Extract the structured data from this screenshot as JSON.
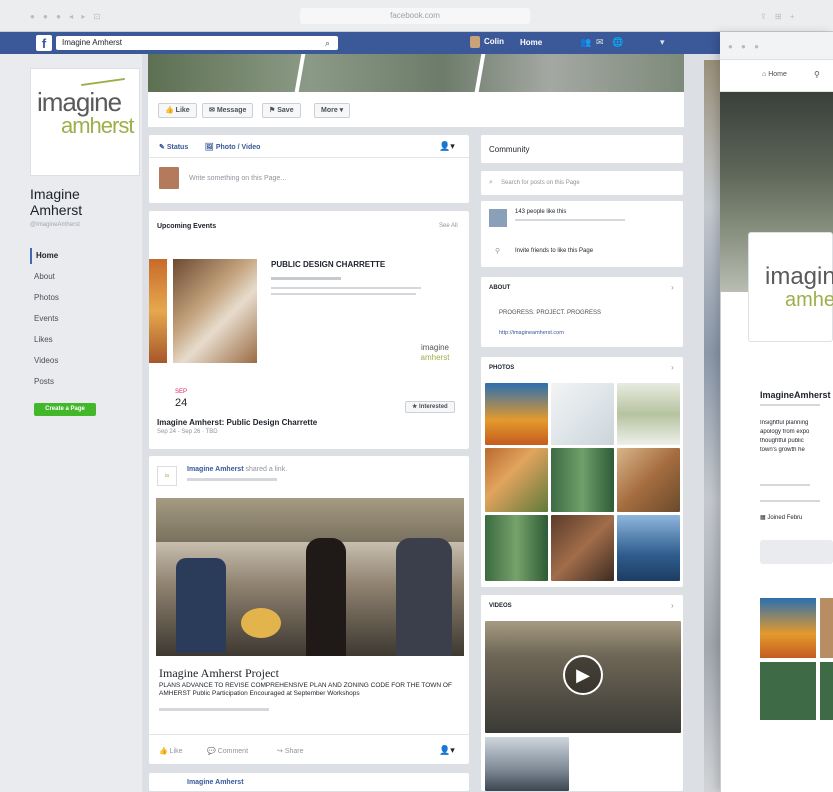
{
  "browser": {
    "url": "facebook.com"
  },
  "fb": {
    "search_value": "Imagine Amherst",
    "user": "Colin",
    "home": "Home"
  },
  "page": {
    "logo_line1": "imagine",
    "logo_line2": "amherst",
    "name_line1": "Imagine",
    "name_line2": "Amherst",
    "handle": "@ImagineAmherst",
    "nav": [
      "Home",
      "About",
      "Photos",
      "Events",
      "Likes",
      "Videos",
      "Posts"
    ],
    "create_page": "Create a Page"
  },
  "actions": {
    "like": "Like",
    "message": "Message",
    "save": "Save",
    "more": "More"
  },
  "composer": {
    "status": "Status",
    "photo_video": "Photo / Video",
    "placeholder": "Write something on this Page..."
  },
  "events": {
    "header": "Upcoming Events",
    "see_all": "See All",
    "charrette_title": "PUBLIC DESIGN CHARRETTE",
    "month": "SEP",
    "day": "24",
    "event_title": "Imagine Amherst: Public Design Charrette",
    "event_dates": "Sep 24 - Sep 26 · TBD",
    "interested": "Interested"
  },
  "post": {
    "author": "Imagine Amherst",
    "shared": "shared a link.",
    "link_title": "Imagine Amherst Project",
    "link_desc": "PLANS ADVANCE TO REVISE COMPREHENSIVE PLAN AND ZONING CODE FOR THE TOWN OF AMHERST Public Participation Encouraged at September Workshops",
    "like": "Like",
    "comment": "Comment",
    "share": "Share"
  },
  "post2": {
    "author": "Imagine Amherst"
  },
  "community": {
    "header": "Community",
    "search": "Search for posts on this Page",
    "likes": "143 people like this",
    "invite": "Invite friends to like this Page"
  },
  "about": {
    "header": "ABOUT",
    "tagline": "PROGRESS. PROJECT. PROGRESS",
    "link": "http://imagineamherst.com"
  },
  "photos": {
    "header": "PHOTOS"
  },
  "videos": {
    "header": "VIDEOS"
  },
  "mobile": {
    "home": "Home",
    "logo_line1": "imagine",
    "logo_line2": "amherst",
    "name": "ImagineAmherst",
    "desc1": "Insightful planning",
    "desc2": "apology from expo",
    "desc3": "thoughtful public",
    "desc4": "town's growth he",
    "joined": "Joined Febru"
  },
  "colors": {
    "fb_blue": "#3b5998",
    "green": "#42b72a",
    "brand_green": "#9cb04a"
  }
}
